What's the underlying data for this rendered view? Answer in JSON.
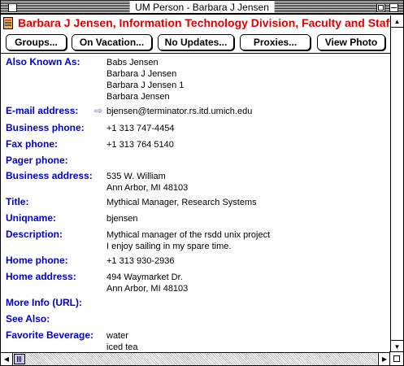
{
  "window": {
    "title": "UM Person - Barbara J Jensen"
  },
  "header": {
    "text": "Barbara J Jensen, Information Technology Division, Faculty and Staff, P"
  },
  "toolbar": {
    "groups": "Groups...",
    "vacation": "On Vacation...",
    "no_updates": "No Updates...",
    "proxies": "Proxies...",
    "view_photo": "View Photo"
  },
  "fields": {
    "aka": {
      "label": "Also Known As:",
      "lines": [
        "Babs Jensen",
        "Barbara J Jensen",
        "Barbara J Jensen 1",
        "Barbara Jensen"
      ]
    },
    "email": {
      "label": "E-mail address:",
      "value": "bjensen@terminator.rs.itd.umich.edu"
    },
    "business_phone": {
      "label": "Business phone:",
      "value": "+1 313 747-4454"
    },
    "fax": {
      "label": "Fax phone:",
      "value": "+1 313 764 5140"
    },
    "pager": {
      "label": "Pager phone:",
      "value": ""
    },
    "business_address": {
      "label": "Business address:",
      "lines": [
        "535 W. William",
        "Ann Arbor, MI 48103"
      ]
    },
    "title": {
      "label": "Title:",
      "value": "Mythical Manager, Research Systems"
    },
    "uniqname": {
      "label": "Uniqname:",
      "value": "bjensen"
    },
    "description": {
      "label": "Description:",
      "lines": [
        "Mythical manager of the rsdd unix project",
        "I enjoy sailing in my spare time."
      ]
    },
    "home_phone": {
      "label": "Home phone:",
      "value": "+1 313 930-2936"
    },
    "home_address": {
      "label": "Home address:",
      "lines": [
        "494 Waymarket Dr.",
        "Ann Arbor, MI 48103"
      ]
    },
    "more_info": {
      "label": "More Info (URL):",
      "value": ""
    },
    "see_also": {
      "label": "See Also:",
      "value": ""
    },
    "beverage": {
      "label": "Favorite Beverage:",
      "lines": [
        "water",
        "iced tea"
      ]
    }
  },
  "icons": {
    "document": "document-icon",
    "arrow": "right-arrow-icon"
  },
  "colors": {
    "header_red": "#e00000",
    "label_blue": "#0000c8"
  }
}
